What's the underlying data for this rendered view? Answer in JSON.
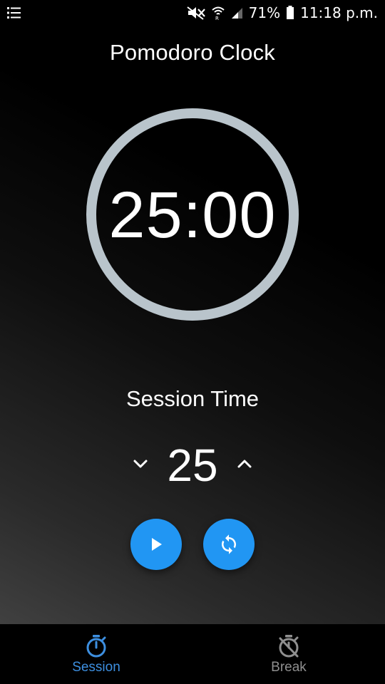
{
  "status_bar": {
    "battery": "71%",
    "time": "11:18 p.m.",
    "icons": [
      "menu-list-icon",
      "mute-icon",
      "wifi-icon",
      "signal-icon",
      "battery-icon"
    ]
  },
  "app": {
    "title": "Pomodoro Clock"
  },
  "timer": {
    "display": "25:00"
  },
  "session": {
    "label": "Session Time",
    "value": "25",
    "decrease_icon": "chevron-down-icon",
    "increase_icon": "chevron-up-icon"
  },
  "controls": {
    "play_icon": "play-icon",
    "reset_icon": "refresh-icon",
    "accent_color": "#2196f3"
  },
  "bottom_nav": {
    "items": [
      {
        "label": "Session",
        "icon": "timer-icon",
        "active": true,
        "color": "#3d8fe0"
      },
      {
        "label": "Break",
        "icon": "timer-off-icon",
        "active": false,
        "color": "#8f8f8f"
      }
    ]
  },
  "colors": {
    "ring": "#b9c4cb",
    "background": "#000000"
  }
}
